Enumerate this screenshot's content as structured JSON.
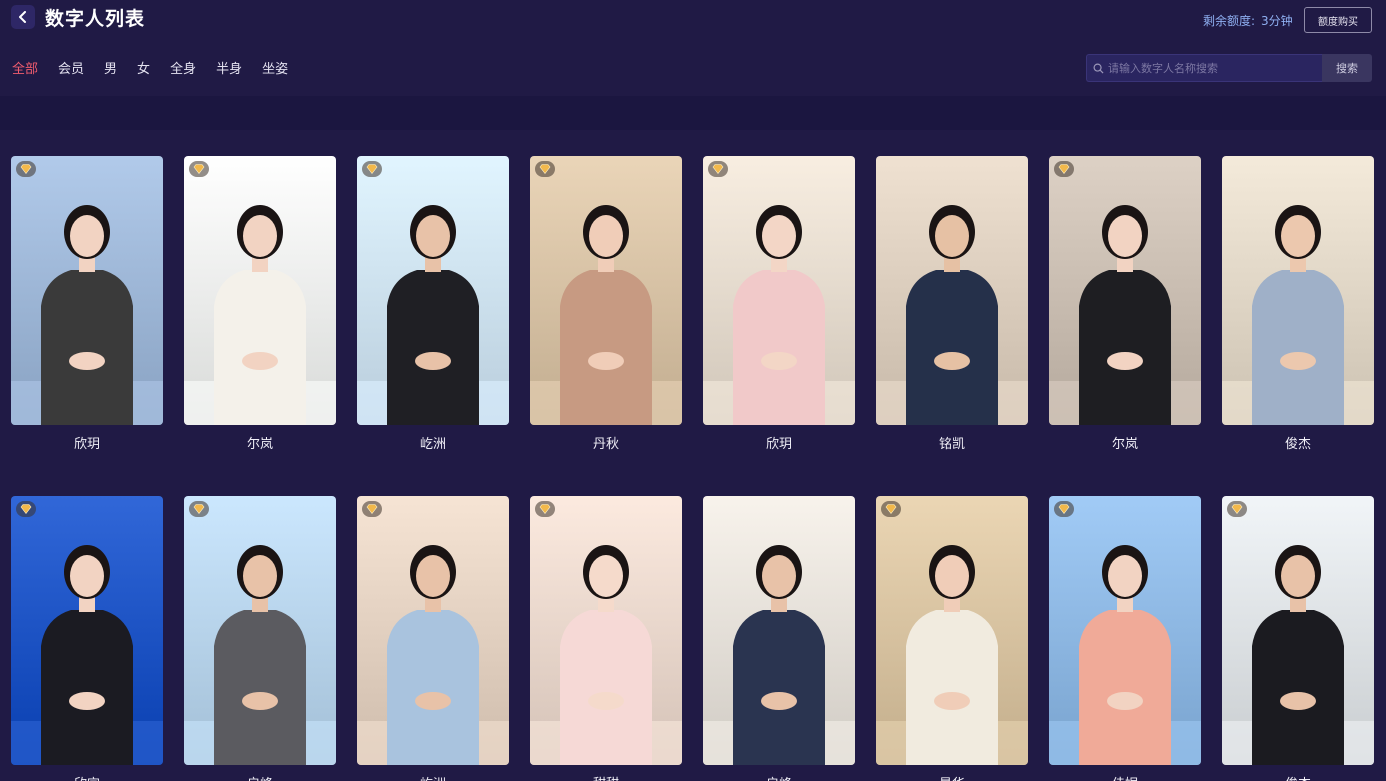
{
  "header": {
    "title": "数字人列表",
    "quota_label": "剩余额度:",
    "quota_value": "3分钟",
    "buy_button": "额度购买"
  },
  "filters": {
    "tabs": [
      "全部",
      "会员",
      "男",
      "女",
      "全身",
      "半身",
      "坐姿"
    ],
    "active": 0
  },
  "search": {
    "placeholder": "请输入数字人名称搜索",
    "button": "搜索"
  },
  "avatars": [
    {
      "name": "欣玥",
      "member": true,
      "bg": "#9fb8d8",
      "outfit": "#3a3a3a",
      "skin": "#f2d3c2",
      "hair": "#1a1414"
    },
    {
      "name": "尔岚",
      "member": true,
      "bg": "#eef0ee",
      "outfit": "#f4f1ea",
      "skin": "#f2d3c2",
      "hair": "#1a1414"
    },
    {
      "name": "屹洲",
      "member": true,
      "bg": "#cfe3f2",
      "outfit": "#1f1f24",
      "skin": "#e8c2a8",
      "hair": "#1a1414"
    },
    {
      "name": "丹秋",
      "member": true,
      "bg": "#d8c3a6",
      "outfit": "#c79a82",
      "skin": "#f0cdb8",
      "hair": "#1a1414"
    },
    {
      "name": "欣玥",
      "member": true,
      "bg": "#e6dccf",
      "outfit": "#f1c9c9",
      "skin": "#f3d6c6",
      "hair": "#1a1414"
    },
    {
      "name": "铭凯",
      "member": false,
      "bg": "#ddcfbf",
      "outfit": "#25304a",
      "skin": "#e6c1a4",
      "hair": "#1a1414"
    },
    {
      "name": "尔岚",
      "member": true,
      "bg": "#cbbfb3",
      "outfit": "#1e1e22",
      "skin": "#f2d3c2",
      "hair": "#1a1414"
    },
    {
      "name": "俊杰",
      "member": false,
      "bg": "#e2d8c8",
      "outfit": "#9fb0c8",
      "skin": "#ecc8ae",
      "hair": "#1a1414"
    },
    {
      "name": "欣宜",
      "member": true,
      "bg": "#1f55c6",
      "outfit": "#1b1b22",
      "skin": "#f2d3c2",
      "hair": "#1a1414"
    },
    {
      "name": "启峰",
      "member": true,
      "bg": "#b9d5ec",
      "outfit": "#5b5b60",
      "skin": "#e8c2a8",
      "hair": "#1a1414"
    },
    {
      "name": "屹洲",
      "member": true,
      "bg": "#e4d2c2",
      "outfit": "#a9c3de",
      "skin": "#e8c2a8",
      "hair": "#1a1414"
    },
    {
      "name": "甜甜",
      "member": true,
      "bg": "#ead8cd",
      "outfit": "#f6d9d6",
      "skin": "#f5dacb",
      "hair": "#1a1414"
    },
    {
      "name": "启峰",
      "member": false,
      "bg": "#e6e1da",
      "outfit": "#2a3450",
      "skin": "#e8c2a8",
      "hair": "#1a1414"
    },
    {
      "name": "曼华",
      "member": true,
      "bg": "#d9c4a2",
      "outfit": "#f1ebdf",
      "skin": "#f0cdb8",
      "hair": "#1a1414"
    },
    {
      "name": "佳妮",
      "member": true,
      "bg": "#8fb9e4",
      "outfit": "#f0aa98",
      "skin": "#f2d3c2",
      "hair": "#1a1414"
    },
    {
      "name": "俊杰",
      "member": true,
      "bg": "#dfe3e6",
      "outfit": "#1b1b20",
      "skin": "#e8c2a8",
      "hair": "#1a1414"
    }
  ]
}
